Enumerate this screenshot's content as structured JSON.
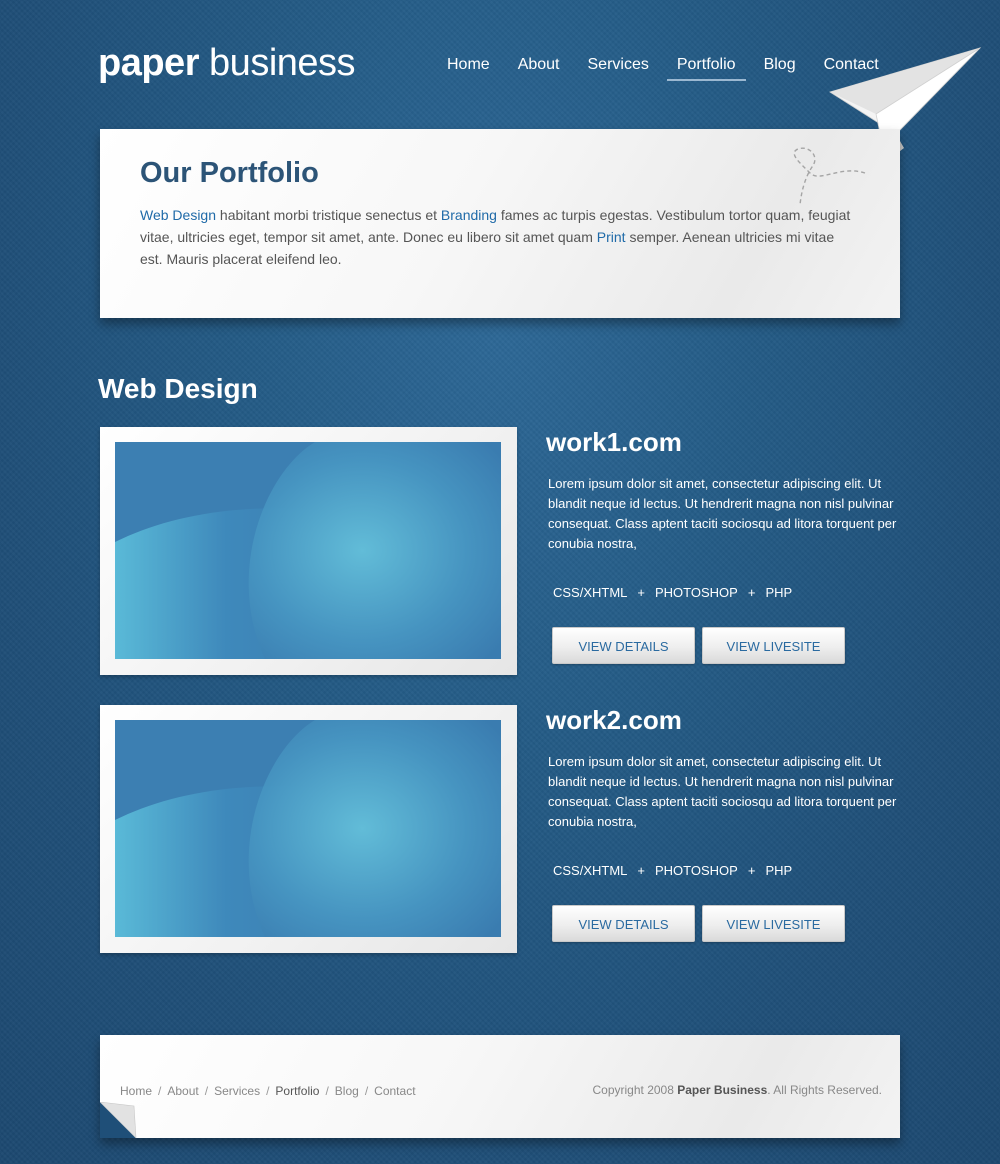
{
  "header": {
    "logo_bold": "paper",
    "logo_light": "business",
    "nav": [
      {
        "label": "Home"
      },
      {
        "label": "About"
      },
      {
        "label": "Services"
      },
      {
        "label": "Portfolio"
      },
      {
        "label": "Blog"
      },
      {
        "label": "Contact"
      }
    ],
    "active_nav": "Portfolio"
  },
  "intro": {
    "title": "Our Portfolio",
    "link1": "Web Design",
    "text1": " habitant morbi tristique senectus et ",
    "link2": "Branding",
    "text2": " fames ac turpis egestas. Vestibulum tortor quam, feugiat vitae, ultricies eget, tempor sit amet, ante. Donec eu libero sit amet quam ",
    "link3": "Print",
    "text3": " semper. Aenean ultricies mi vitae est. Mauris placerat eleifend leo."
  },
  "section": {
    "title": "Web Design"
  },
  "works": [
    {
      "title": "work1.com",
      "description": "Lorem ipsum dolor sit amet, consectetur adipiscing elit. Ut blandit neque id lectus. Ut hendrerit magna non nisl pulvinar consequat. Class aptent taciti sociosqu ad litora torquent per conubia nostra,",
      "tech1": "CSS/XHTML",
      "tech2": "PHOTOSHOP",
      "tech3": "PHP",
      "plus": "+",
      "details_label": "VIEW DETAILS",
      "live_label": "VIEW LIVESITE"
    },
    {
      "title": "work2.com",
      "description": "Lorem ipsum dolor sit amet, consectetur adipiscing elit. Ut blandit neque id lectus. Ut hendrerit magna non nisl pulvinar consequat. Class aptent taciti sociosqu ad litora torquent per conubia nostra,",
      "tech1": "CSS/XHTML",
      "tech2": "PHOTOSHOP",
      "tech3": "PHP",
      "plus": "+",
      "details_label": "VIEW DETAILS",
      "live_label": "VIEW LIVESITE"
    }
  ],
  "footer": {
    "crumbs": [
      "Home",
      "About",
      "Services",
      "Portfolio",
      "Blog",
      "Contact"
    ],
    "separator": "/",
    "copy_prefix": "Copyright 2008 ",
    "copy_brand": "Paper Business",
    "copy_suffix": ". All Rights Reserved."
  },
  "colors": {
    "background": "#245b86",
    "heading": "#2c5477",
    "link": "#1f6aa8",
    "button_text": "#2a6aa0"
  }
}
